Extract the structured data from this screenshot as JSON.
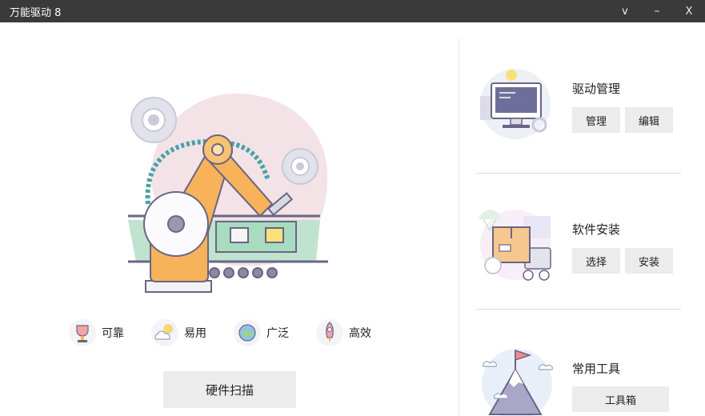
{
  "window": {
    "title": "万能驱动 8",
    "dropdown_glyph": "v",
    "minimize_glyph": "–",
    "close_glyph": "X"
  },
  "features": [
    {
      "label": "可靠",
      "icon": "trophy-icon"
    },
    {
      "label": "易用",
      "icon": "cloud-sun-icon"
    },
    {
      "label": "广泛",
      "icon": "globe-icon"
    },
    {
      "label": "高效",
      "icon": "rocket-icon"
    }
  ],
  "scan_button": {
    "label": "硬件扫描"
  },
  "sections": {
    "driver": {
      "title": "驱动管理",
      "buttons": [
        "管理",
        "编辑"
      ],
      "icon": "monitor-icon"
    },
    "software": {
      "title": "软件安装",
      "buttons": [
        "选择",
        "安装"
      ],
      "icon": "parcel-delivery-icon"
    },
    "tools": {
      "title": "常用工具",
      "buttons": [
        "工具箱"
      ],
      "icon": "mountain-flag-icon"
    }
  },
  "colors": {
    "titlebar": "#3a3a3a",
    "button_bg": "#ececec",
    "robot_orange": "#f7b25a",
    "line_dark": "#6a6585"
  }
}
